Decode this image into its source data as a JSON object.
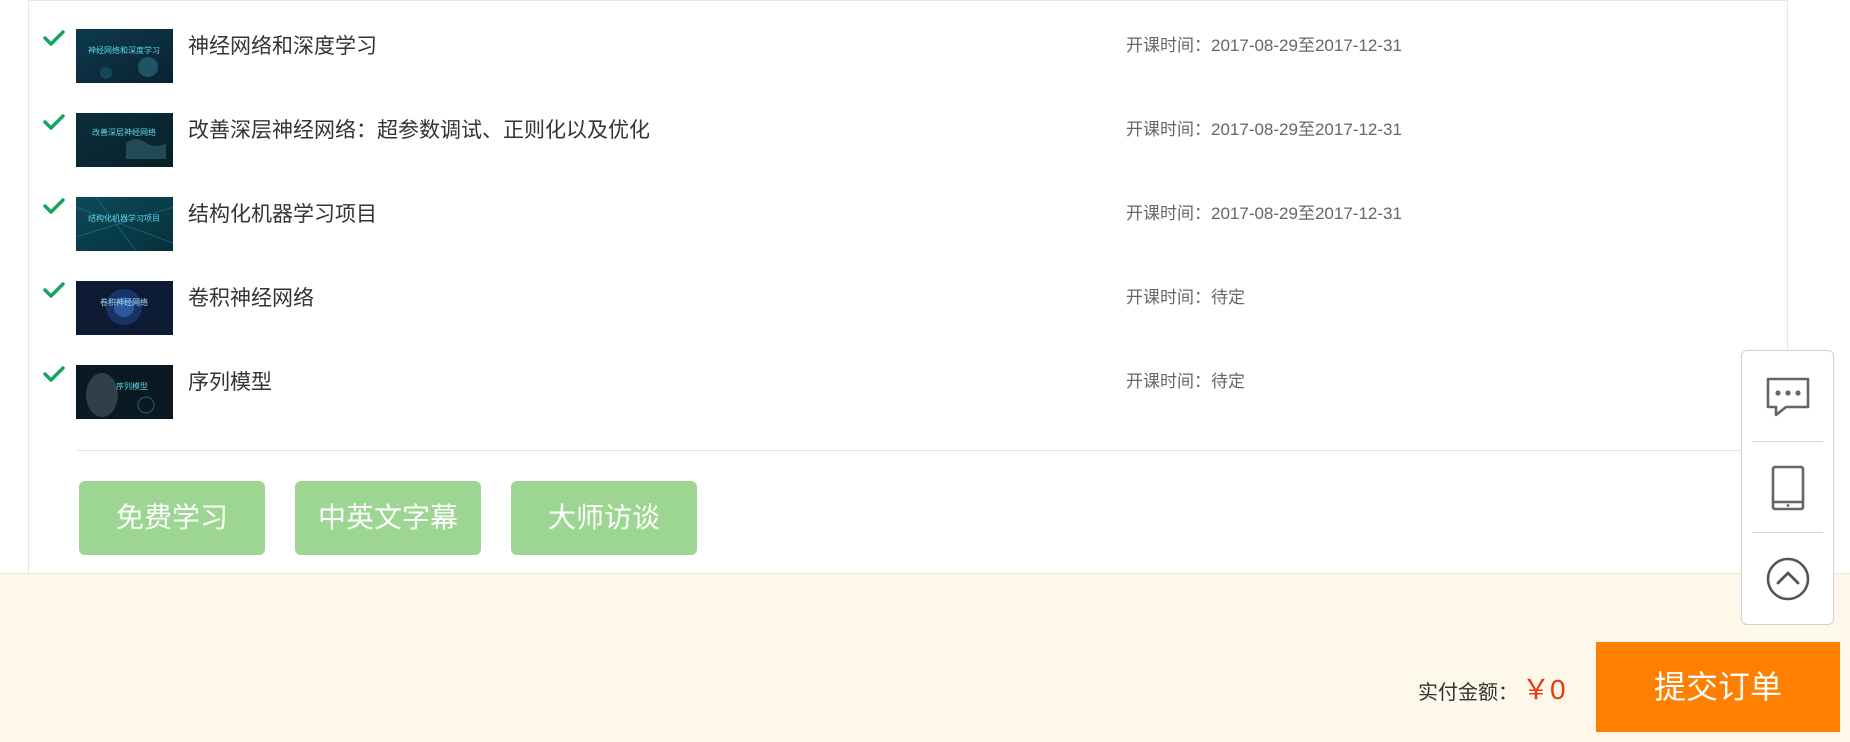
{
  "courses": [
    {
      "title": "神经网络和深度学习",
      "time": "开课时间：2017-08-29至2017-12-31",
      "thumb_text": "神经网络和深度学习"
    },
    {
      "title": "改善深层神经网络：超参数调试、正则化以及优化",
      "time": "开课时间：2017-08-29至2017-12-31",
      "thumb_text": "改善深层神经网络"
    },
    {
      "title": "结构化机器学习项目",
      "time": "开课时间：2017-08-29至2017-12-31",
      "thumb_text": "结构化机器学习项目"
    },
    {
      "title": "卷积神经网络",
      "time": "开课时间：待定",
      "thumb_text": "卷积神经网络"
    },
    {
      "title": "序列模型",
      "time": "开课时间：待定",
      "thumb_text": "序列模型"
    }
  ],
  "tags": [
    "免费学习",
    "中英文字幕",
    "大师访谈"
  ],
  "footer": {
    "amount_label": "实付金额：",
    "amount_value": "￥0",
    "submit_label": "提交订单"
  },
  "side_toolbar": {
    "icons": [
      "chat-icon",
      "tablet-icon",
      "back-to-top-icon"
    ]
  },
  "colors": {
    "check": "#1aa260",
    "tag_bg": "#9dd592",
    "submit_bg": "#ff7f00",
    "amount": "#e8380d",
    "footer_bg": "#fdf8ea"
  }
}
